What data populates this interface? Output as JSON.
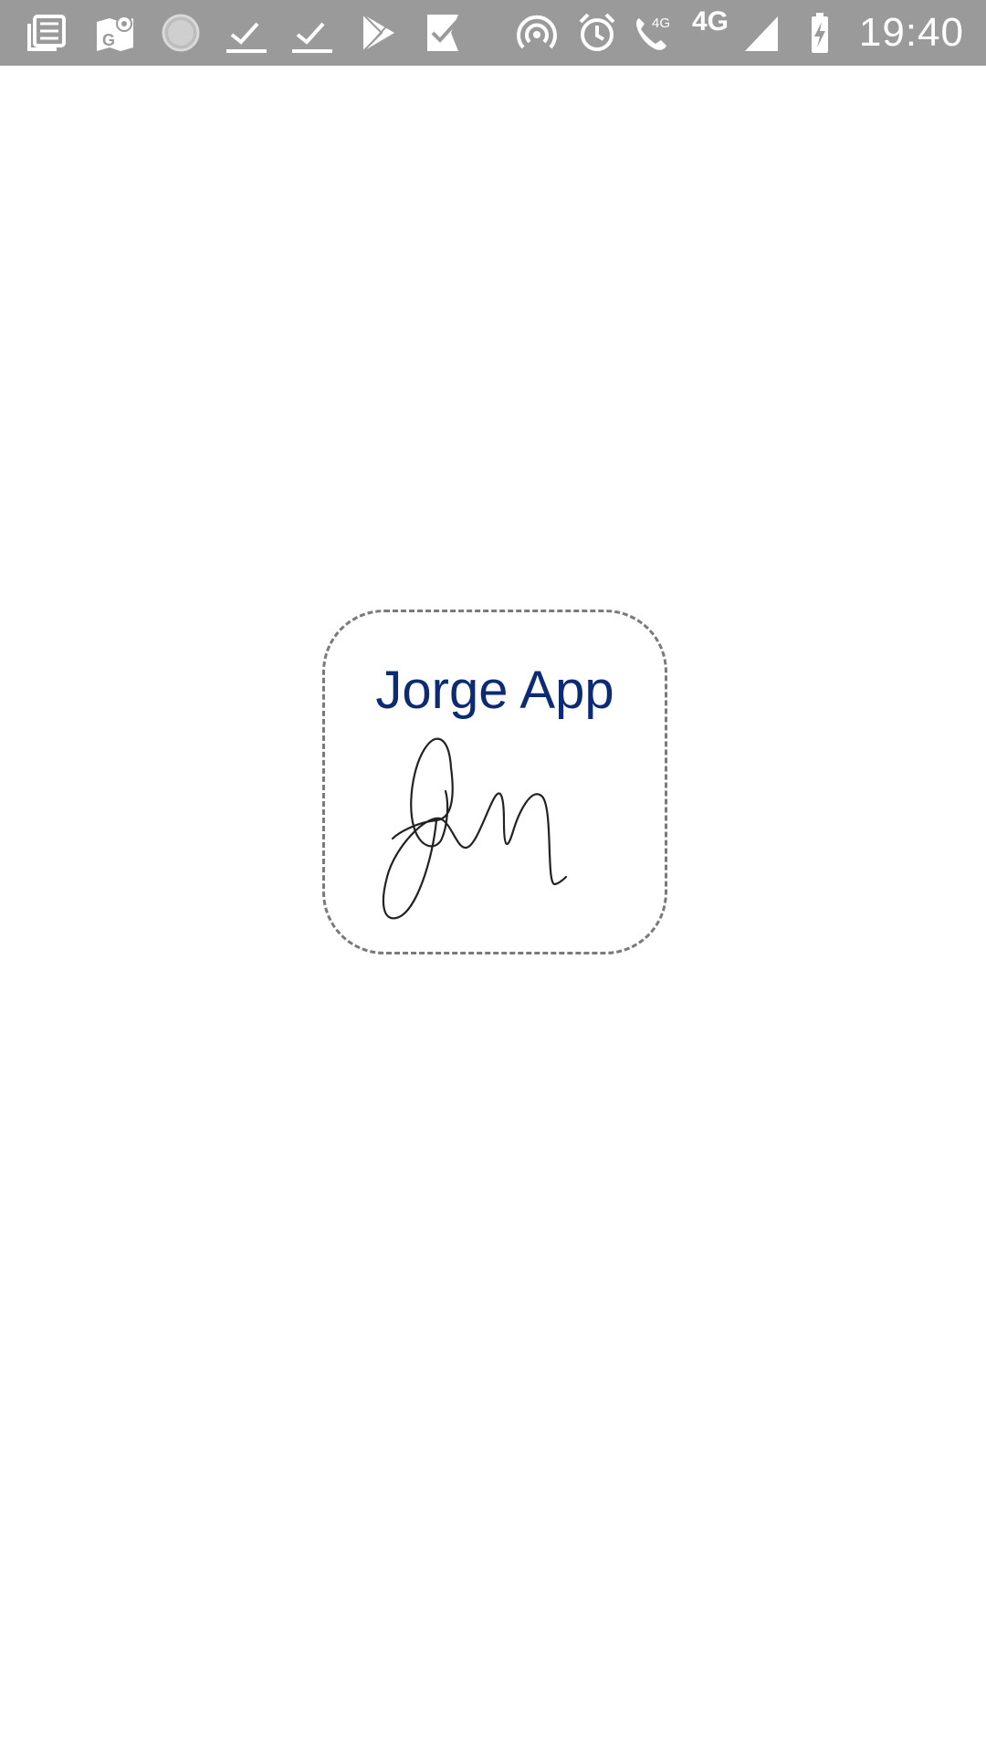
{
  "status_bar": {
    "time": "19:40",
    "network_label_small": "4G",
    "network_label": "4G",
    "icons": [
      "news-icon",
      "maps-icon",
      "loading-icon",
      "check-icon",
      "check-icon",
      "play-store-icon",
      "task-check-icon",
      "hotspot-icon",
      "alarm-icon",
      "volte-call-icon",
      "signal-icon",
      "battery-charging-icon"
    ]
  },
  "splash": {
    "app_title": "Jorge App",
    "logo_icon": "signature-icon",
    "colors": {
      "title": "#0c2b74",
      "status_bar": "#9a9a9a",
      "background": "#ffffff"
    }
  }
}
